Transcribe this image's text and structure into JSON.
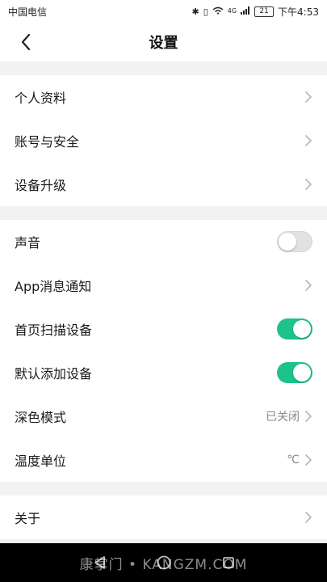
{
  "status_bar": {
    "carrier": "中国电信",
    "network": "4G",
    "battery": "21",
    "time": "下午4:53"
  },
  "header": {
    "title": "设置"
  },
  "group1": {
    "items": [
      {
        "label": "个人资料"
      },
      {
        "label": "账号与安全"
      },
      {
        "label": "设备升级"
      }
    ]
  },
  "group2": {
    "items": [
      {
        "label": "声音",
        "toggle": "off"
      },
      {
        "label": "App消息通知"
      },
      {
        "label": "首页扫描设备",
        "toggle": "on"
      },
      {
        "label": "默认添加设备",
        "toggle": "on"
      },
      {
        "label": "深色模式",
        "value": "已关闭"
      },
      {
        "label": "温度单位",
        "value": "℃"
      }
    ]
  },
  "group3": {
    "items": [
      {
        "label": "关于"
      }
    ]
  },
  "watermark": "康掌门 • KANGZM.COM",
  "colors": {
    "accent": "#1ec28b",
    "toggle_off": "#e1e1e1",
    "background": "#f2f2f2",
    "chevron": "#b5b5b5"
  }
}
